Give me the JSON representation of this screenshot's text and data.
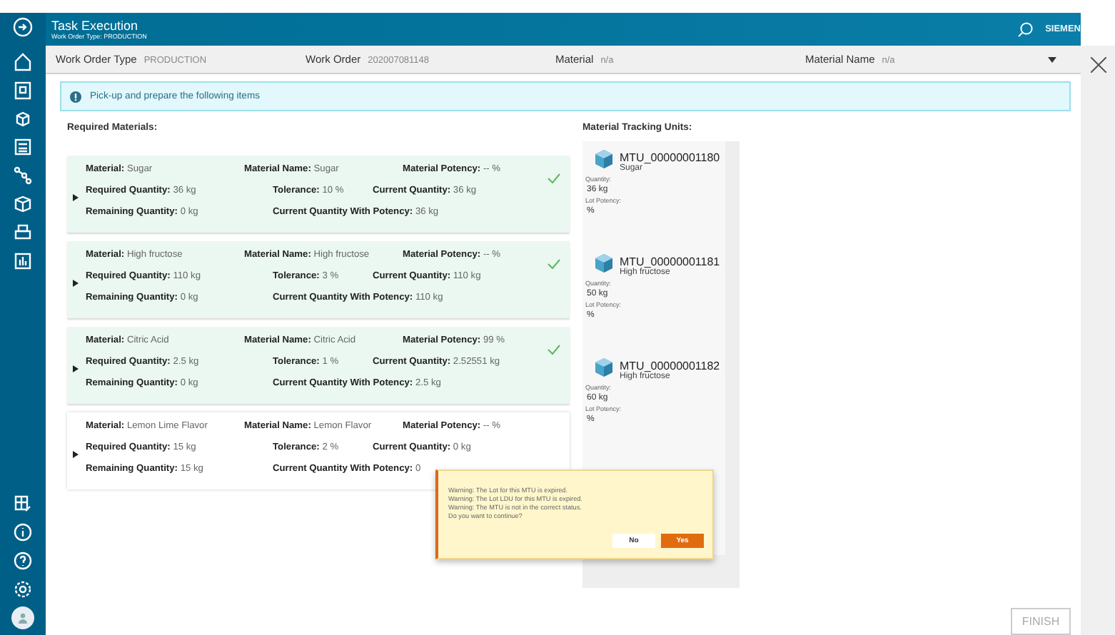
{
  "header": {
    "title": "Task Execution",
    "subtitle": "Work Order Type: PRODUCTION",
    "brand": "SIEMEN"
  },
  "filters": [
    {
      "label": "Work Order Type",
      "value": "PRODUCTION"
    },
    {
      "label": "Work Order",
      "value": "202007081148"
    },
    {
      "label": "Material",
      "value": "n/a"
    },
    {
      "label": "Material Name",
      "value": "n/a"
    }
  ],
  "info": "Pick-up and prepare the following items",
  "required_heading": "Required Materials:",
  "materials": [
    {
      "complete": true,
      "rows": [
        [
          {
            "label": "Material:",
            "value": "Sugar"
          },
          {
            "label": "Material Name:",
            "value": "Sugar"
          },
          {
            "label": "Material Potency:",
            "value": "-- %"
          }
        ],
        [
          {
            "label": "Required Quantity:",
            "value": "36 kg"
          },
          {
            "label": "Tolerance:",
            "value": "10 %"
          },
          {
            "label": "Current Quantity:",
            "value": "36 kg"
          }
        ],
        [
          {
            "label": "Remaining Quantity:",
            "value": "0 kg"
          },
          {
            "label": "Current Quantity With Potency:",
            "value": "36 kg"
          }
        ]
      ]
    },
    {
      "complete": true,
      "rows": [
        [
          {
            "label": "Material:",
            "value": "High fructose"
          },
          {
            "label": "Material Name:",
            "value": "High fructose"
          },
          {
            "label": "Material Potency:",
            "value": "-- %"
          }
        ],
        [
          {
            "label": "Required Quantity:",
            "value": "110 kg"
          },
          {
            "label": "Tolerance:",
            "value": "3 %"
          },
          {
            "label": "Current Quantity:",
            "value": "110 kg"
          }
        ],
        [
          {
            "label": "Remaining Quantity:",
            "value": "0 kg"
          },
          {
            "label": "Current Quantity With Potency:",
            "value": "110 kg"
          }
        ]
      ]
    },
    {
      "complete": true,
      "rows": [
        [
          {
            "label": "Material:",
            "value": "Citric Acid"
          },
          {
            "label": "Material Name:",
            "value": "Citric Acid"
          },
          {
            "label": "Material Potency:",
            "value": "99 %"
          }
        ],
        [
          {
            "label": "Required Quantity:",
            "value": "2.5 kg"
          },
          {
            "label": "Tolerance:",
            "value": "1 %"
          },
          {
            "label": "Current Quantity:",
            "value": "2.52551 kg"
          }
        ],
        [
          {
            "label": "Remaining Quantity:",
            "value": "0 kg"
          },
          {
            "label": "Current Quantity With Potency:",
            "value": "2.5 kg"
          }
        ]
      ]
    },
    {
      "complete": false,
      "rows": [
        [
          {
            "label": "Material:",
            "value": "Lemon Lime Flavor"
          },
          {
            "label": "Material Name:",
            "value": "Lemon Flavor"
          },
          {
            "label": "Material Potency:",
            "value": "-- %"
          }
        ],
        [
          {
            "label": "Required Quantity:",
            "value": "15 kg"
          },
          {
            "label": "Tolerance:",
            "value": "2 %"
          },
          {
            "label": "Current Quantity:",
            "value": "0 kg"
          }
        ],
        [
          {
            "label": "Remaining Quantity:",
            "value": "15 kg"
          },
          {
            "label": "Current Quantity With Potency:",
            "value": "0"
          }
        ]
      ]
    }
  ],
  "mtu_heading": "Material Tracking Units:",
  "mtus": [
    {
      "id": "MTU_00000001180",
      "material": "Sugar",
      "quantity_label": "Quantity:",
      "quantity": "36 kg",
      "potency_label": "Lot Potency:",
      "potency": "%"
    },
    {
      "id": "MTU_00000001181",
      "material": "High fructose",
      "quantity_label": "Quantity:",
      "quantity": "50 kg",
      "potency_label": "Lot Potency:",
      "potency": "%"
    },
    {
      "id": "MTU_00000001182",
      "material": "High fructose",
      "quantity_label": "Quantity:",
      "quantity": "60 kg",
      "potency_label": "Lot Potency:",
      "potency": "%"
    }
  ],
  "dialog": {
    "lines": [
      "Warning: The Lot for this MTU is expired.",
      "Warning: The Lot LDU for this MTU is expired.",
      "Warning: The MTU is not in the correct status.",
      "Do you want to continue?"
    ],
    "buttons": [
      {
        "label": "No",
        "kind": "secondary"
      },
      {
        "label": "Yes",
        "kind": "primary"
      }
    ]
  },
  "finish": "FINISH"
}
